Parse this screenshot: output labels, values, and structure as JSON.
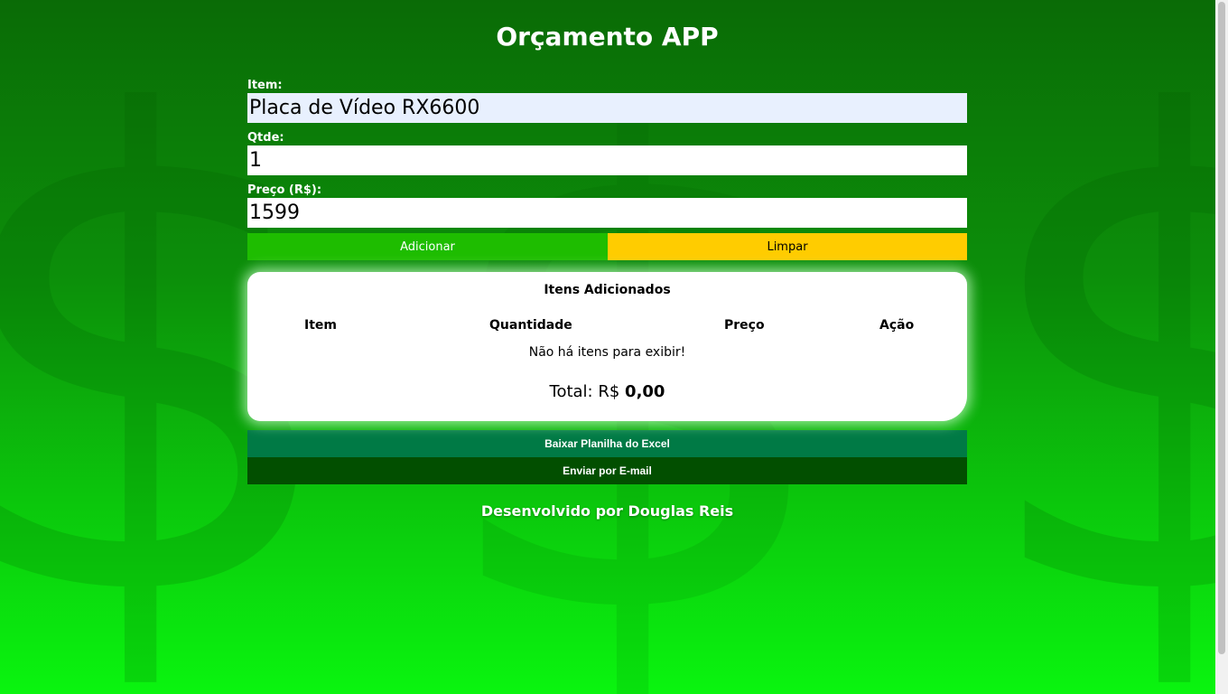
{
  "app": {
    "title": "Orçamento APP"
  },
  "background": {
    "symbol": "$"
  },
  "form": {
    "item_label": "Item:",
    "item_value": "Placa de Vídeo RX6600",
    "qty_label": "Qtde:",
    "qty_value": "1",
    "price_label": "Preço (R$):",
    "price_value": "1599",
    "add_button": "Adicionar",
    "clear_button": "Limpar"
  },
  "items_card": {
    "title": "Itens Adicionados",
    "columns": [
      "Item",
      "Quantidade",
      "Preço",
      "Ação"
    ],
    "empty_message": "Não há itens para exibir!",
    "total_label": "Total: R$",
    "total_value": "0,00"
  },
  "actions": {
    "excel_button": "Baixar Planilha do Excel",
    "email_button": "Enviar por E-mail"
  },
  "footer": {
    "text": "Desenvolvido por Douglas Reis"
  },
  "colors": {
    "add_button": "#1ebd00",
    "clear_button": "#ffcc00",
    "excel_button": "#007a45",
    "email_button": "#024f00"
  }
}
